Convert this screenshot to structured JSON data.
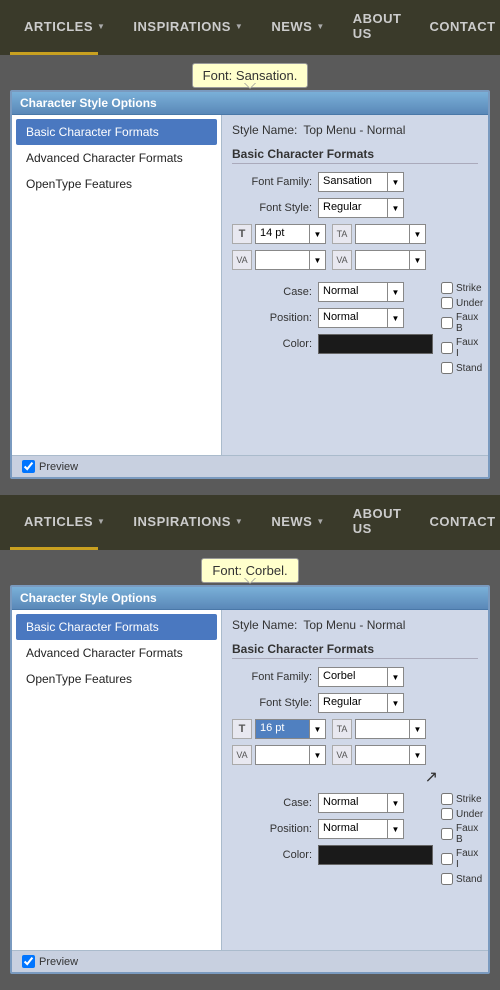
{
  "panel1": {
    "nav": {
      "items": [
        {
          "label": "ARTICLES",
          "hasArrow": true
        },
        {
          "label": "INSPIRATIONS",
          "hasArrow": true
        },
        {
          "label": "NEWS",
          "hasArrow": true
        },
        {
          "label": "ABOUT US",
          "hasArrow": false
        },
        {
          "label": "CONTACT",
          "hasArrow": false
        }
      ]
    },
    "tooltip": "Font: Sansation.",
    "dialog": {
      "title": "Character Style Options",
      "sidebar": {
        "items": [
          {
            "label": "Basic Character Formats",
            "active": true
          },
          {
            "label": "Advanced Character Formats",
            "active": false
          },
          {
            "label": "OpenType Features",
            "active": false
          }
        ]
      },
      "main": {
        "style_name_label": "Style Name:",
        "style_name_value": "Top Menu - Normal",
        "section_title": "Basic Character Formats",
        "font_family_label": "Font Family:",
        "font_family_value": "Sansation",
        "font_style_label": "Font Style:",
        "font_style_value": "Regular",
        "size_value": "14 pt",
        "case_label": "Case:",
        "case_value": "Normal",
        "position_label": "Position:",
        "position_value": "Normal",
        "color_label": "Color:",
        "checkboxes": [
          {
            "label": "Strike"
          },
          {
            "label": "Under"
          },
          {
            "label": "Faux B"
          },
          {
            "label": "Faux I"
          },
          {
            "label": "Stand"
          }
        ]
      },
      "preview_label": "Preview"
    }
  },
  "panel2": {
    "nav": {
      "items": [
        {
          "label": "ARTICLES",
          "hasArrow": true
        },
        {
          "label": "INSPIRATIONS",
          "hasArrow": true
        },
        {
          "label": "NEWS",
          "hasArrow": true
        },
        {
          "label": "ABOUT US",
          "hasArrow": false
        },
        {
          "label": "CONTACT",
          "hasArrow": false
        }
      ]
    },
    "tooltip": "Font: Corbel.",
    "dialog": {
      "title": "Character Style Options",
      "sidebar": {
        "items": [
          {
            "label": "Basic Character Formats",
            "active": true
          },
          {
            "label": "Advanced Character Formats",
            "active": false
          },
          {
            "label": "OpenType Features",
            "active": false
          }
        ]
      },
      "main": {
        "style_name_label": "Style Name:",
        "style_name_value": "Top Menu - Normal",
        "section_title": "Basic Character Formats",
        "font_family_label": "Font Family:",
        "font_family_value": "Corbel",
        "font_style_label": "Font Style:",
        "font_style_value": "Regular",
        "size_value": "16 pt",
        "case_label": "Case:",
        "case_value": "Normal",
        "position_label": "Position:",
        "position_value": "Normal",
        "color_label": "Color:",
        "checkboxes": [
          {
            "label": "Strike"
          },
          {
            "label": "Under"
          },
          {
            "label": "Faux B"
          },
          {
            "label": "Faux I"
          },
          {
            "label": "Stand"
          }
        ]
      },
      "preview_label": "Preview"
    }
  }
}
